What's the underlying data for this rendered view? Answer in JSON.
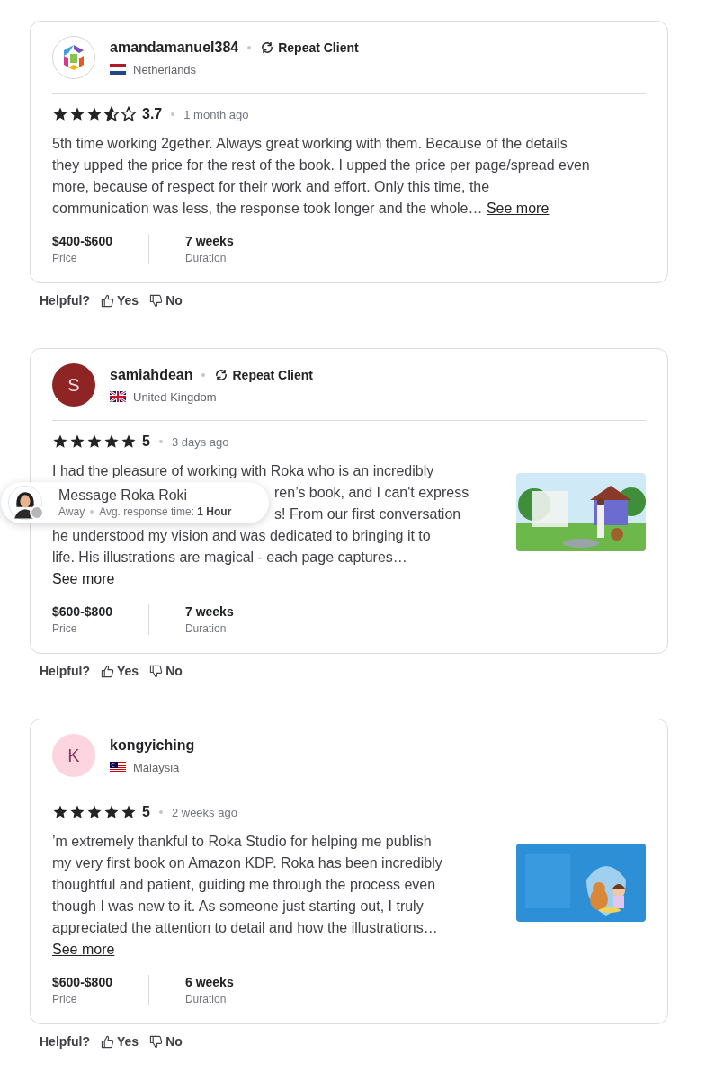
{
  "reviews": [
    {
      "avatar": {
        "kind": "logo"
      },
      "name": "amandamanuel384",
      "badge": "Repeat Client",
      "country": "Netherlands",
      "stars": 3.5,
      "rating": "3.7",
      "time": "1 month ago",
      "body_lines": [
        {
          "kind": "full",
          "text": "5th time working 2gether. Always great working with them. Because of the details"
        },
        {
          "kind": "full",
          "text": "they upped the price for the rest of the book. I upped the price per page/spread even"
        },
        {
          "kind": "full",
          "text": "more, because of respect for their work and effort. Only this time, the"
        },
        {
          "kind": "full",
          "text": "communication was less, the response took longer and the whole…",
          "link": "See more"
        }
      ],
      "price": "$400-$600",
      "price_label": "Price",
      "duration": "7 weeks",
      "duration_label": "Duration",
      "helpful": "Helpful?",
      "yes": "Yes",
      "no": "No"
    },
    {
      "avatar": {
        "kind": "letter",
        "letter": "S",
        "color": "#8e2424"
      },
      "name": "samiahdean",
      "badge": "Repeat Client",
      "country": "United Kingdom",
      "stars": 5,
      "rating": "5",
      "time": "3 days ago",
      "body_lines": [
        {
          "kind": "full",
          "text": "I had the pleasure of working with Roka who is an incredibly"
        },
        {
          "kind": "partial",
          "text": "ren’s book, and I can't express"
        },
        {
          "kind": "partial",
          "text": "s! From our first conversation"
        },
        {
          "kind": "full",
          "text": "he understood my vision and was dedicated to bringing it to"
        },
        {
          "kind": "full",
          "text": "life. His illustrations are magical - each page captures…"
        },
        {
          "kind": "link",
          "text": "See more"
        }
      ],
      "price": "$600-$800",
      "price_label": "Price",
      "duration": "7 weeks",
      "duration_label": "Duration",
      "helpful": "Helpful?",
      "yes": "Yes",
      "no": "No"
    },
    {
      "avatar": {
        "kind": "letter",
        "letter": "K",
        "color": "#fdd5e1"
      },
      "name": "kongyiching",
      "country": "Malaysia",
      "stars": 5,
      "rating": "5",
      "time": "2 weeks ago",
      "body_lines": [
        {
          "kind": "full",
          "text": "’m extremely thankful to Roka Studio for helping me publish"
        },
        {
          "kind": "full",
          "text": "my very first book on Amazon KDP. Roka has been incredibly"
        },
        {
          "kind": "full",
          "text": "thoughtful and patient, guiding me through the process even"
        },
        {
          "kind": "full",
          "text": "though I was new to it. As someone just starting out, I truly"
        },
        {
          "kind": "full",
          "text": "appreciated the attention to detail and how the illustrations…"
        },
        {
          "kind": "link",
          "text": "See more"
        }
      ],
      "price": "$600-$800",
      "price_label": "Price",
      "duration": "6 weeks",
      "duration_label": "Duration",
      "helpful": "Helpful?",
      "yes": "Yes",
      "no": "No"
    }
  ],
  "message_popup": {
    "title": "Message Roka Roki",
    "status": "Away",
    "response": "Avg. response time: **1 Hour**",
    "online": false
  }
}
